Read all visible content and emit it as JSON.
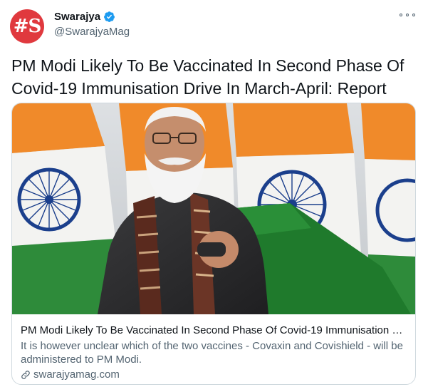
{
  "author": {
    "display_name": "Swarajya",
    "handle": "@SwarajyaMag",
    "avatar_text": "#S",
    "avatar_color": "#e0393e",
    "verified_color": "#1d9bf0"
  },
  "tweet": {
    "text": "PM Modi Likely To Be Vaccinated In Second Phase Of Covid-19 Immunisation Drive In March-April: Report"
  },
  "card": {
    "title": "PM Modi Likely To Be Vaccinated In Second Phase Of Covid-19 Immunisation Dri...",
    "description": "It is however unclear which of the two vaccines - Covaxin and Covishield - will be administered to PM Modi.",
    "domain": "swarajyamag.com"
  },
  "icons": {
    "more": "more-icon",
    "verified": "verified-badge-icon",
    "link": "link-icon"
  }
}
